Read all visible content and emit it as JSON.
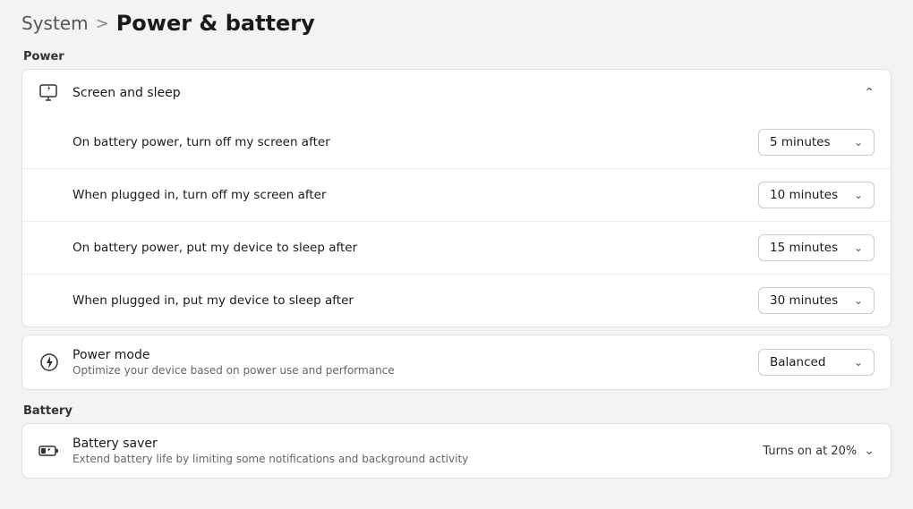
{
  "breadcrumb": {
    "system_label": "System",
    "separator": ">",
    "current_label": "Power & battery"
  },
  "power_section": {
    "label": "Power",
    "screen_sleep": {
      "title": "Screen and sleep",
      "rows": [
        {
          "id": "battery-screen-off",
          "label": "On battery power, turn off my screen after",
          "value": "5 minutes"
        },
        {
          "id": "plugged-screen-off",
          "label": "When plugged in, turn off my screen after",
          "value": "10 minutes"
        },
        {
          "id": "battery-sleep",
          "label": "On battery power, put my device to sleep after",
          "value": "15 minutes"
        },
        {
          "id": "plugged-sleep",
          "label": "When plugged in, put my device to sleep after",
          "value": "30 minutes"
        }
      ]
    },
    "power_mode": {
      "title": "Power mode",
      "subtitle": "Optimize your device based on power use and performance",
      "value": "Balanced"
    }
  },
  "battery_section": {
    "label": "Battery",
    "battery_saver": {
      "title": "Battery saver",
      "subtitle": "Extend battery life by limiting some notifications and background activity",
      "turns_on_label": "Turns on at 20%"
    }
  },
  "icons": {
    "screen_sleep": "monitor-icon",
    "power_mode": "power-icon",
    "battery_saver": "battery-icon",
    "chevron_up": "chevron-up-icon",
    "chevron_down": "chevron-down-icon"
  }
}
